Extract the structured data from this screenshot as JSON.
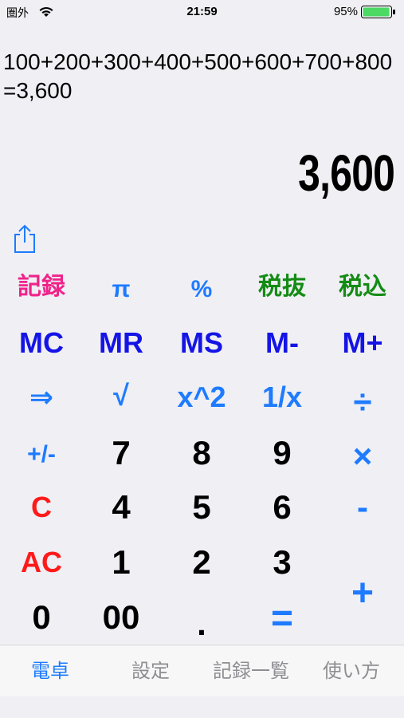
{
  "status": {
    "carrier": "圏外",
    "time": "21:59",
    "battery": "95%"
  },
  "display": {
    "expression": "100+200+300+400+500+600+700+800=3,600",
    "result": "3,600"
  },
  "keys": {
    "record": "記録",
    "pi": "π",
    "percent": "%",
    "tax_excl": "税抜",
    "tax_incl": "税込",
    "mc": "MC",
    "mr": "MR",
    "ms": "MS",
    "m_minus": "M-",
    "m_plus": "M+",
    "arrow": "⇒",
    "sqrt": "√",
    "square": "x^2",
    "reciprocal": "1/x",
    "divide": "÷",
    "plus_minus": "+/-",
    "seven": "7",
    "eight": "8",
    "nine": "9",
    "multiply": "×",
    "clear": "C",
    "four": "4",
    "five": "5",
    "six": "6",
    "minus": "-",
    "all_clear": "AC",
    "one": "1",
    "two": "2",
    "three": "3",
    "plus": "+",
    "zero": "0",
    "double_zero": "00",
    "dot": ".",
    "equals": "="
  },
  "tabs": [
    "電卓",
    "設定",
    "記録一覧",
    "使い方"
  ],
  "colors": {
    "blue": "#1e7bff",
    "dark_blue": "#1414e6",
    "pink": "#f0238a",
    "green": "#148c14",
    "red": "#ff1a1a"
  }
}
